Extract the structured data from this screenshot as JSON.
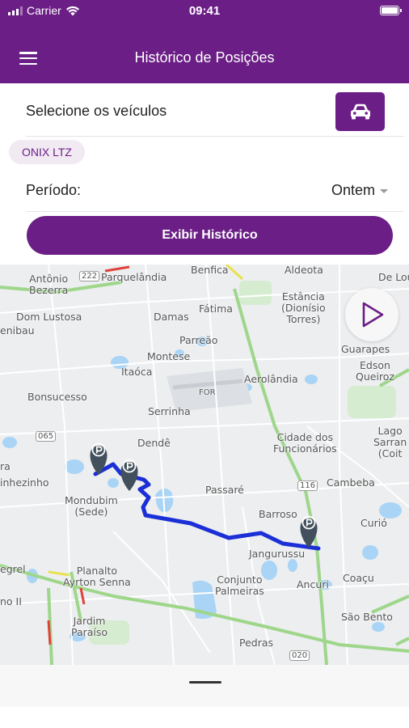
{
  "status_bar": {
    "carrier": "Carrier",
    "time": "09:41"
  },
  "header": {
    "title": "Histórico de Posições"
  },
  "vehicles": {
    "label": "Selecione os veículos",
    "selected_chip": "ONIX LTZ"
  },
  "period": {
    "label": "Período:",
    "value": "Ontem"
  },
  "show_history_button": "Exibir Histórico",
  "map": {
    "labels": {
      "antonio_bezerra": "Antônio\nBezerra",
      "route_222": "222",
      "parquelandia": "Parquelândia",
      "benfica": "Benfica",
      "aldeota": "Aldeota",
      "de_lou": "De Lou",
      "dom_lustosa": "Dom Lustosa",
      "enibau": "enibau",
      "damas": "Damas",
      "fatima": "Fátima",
      "estancia": "Estância\n(Dionísio\nTorres)",
      "parreao": "Parreão",
      "guarapes": "Guarapes",
      "montese": "Montese",
      "itaoca": "Itaóca",
      "edson_queiroz": "Edson\nQueiroz",
      "aerolandia": "Aerolândia",
      "bonsucesso": "Bonsucesso",
      "for": "FOR",
      "serrinha": "Serrinha",
      "route_065": "065",
      "cidade_funcionarios": "Cidade dos\nFuncionários",
      "lago_sarran": "Lago\nSarran\n(Coit",
      "dende": "Dendê",
      "route_116": "116",
      "cambeba": "Cambeba",
      "ra": "ra",
      "inhezinho": "inhezinho",
      "passare": "Passaré",
      "mondubim": "Mondubim\n(Sede)",
      "barroso": "Barroso",
      "curio": "Curió",
      "jangurussu": "Jangurussu",
      "planalto": "Planalto\nAyrton Senna",
      "egrel": "egrel",
      "conjunto_palmeiras": "Conjunto\nPalmeiras",
      "ancuri": "Ancuri",
      "coacu": "Coaçu",
      "no_ii": "no II",
      "jardim_paraiso": "Jardim\nParaíso",
      "sao_bento": "São Bento",
      "pedras": "Pedras",
      "route_020": "020"
    },
    "marker_icon": "parking-marker-icon",
    "route_color": "#1b2fd6"
  },
  "icons": {
    "menu": "menu-icon",
    "car": "car-icon",
    "play": "play-icon",
    "wifi": "wifi-icon",
    "battery": "battery-icon"
  },
  "colors": {
    "brand": "#6b1f86",
    "chip_bg": "#f1eaf3"
  }
}
